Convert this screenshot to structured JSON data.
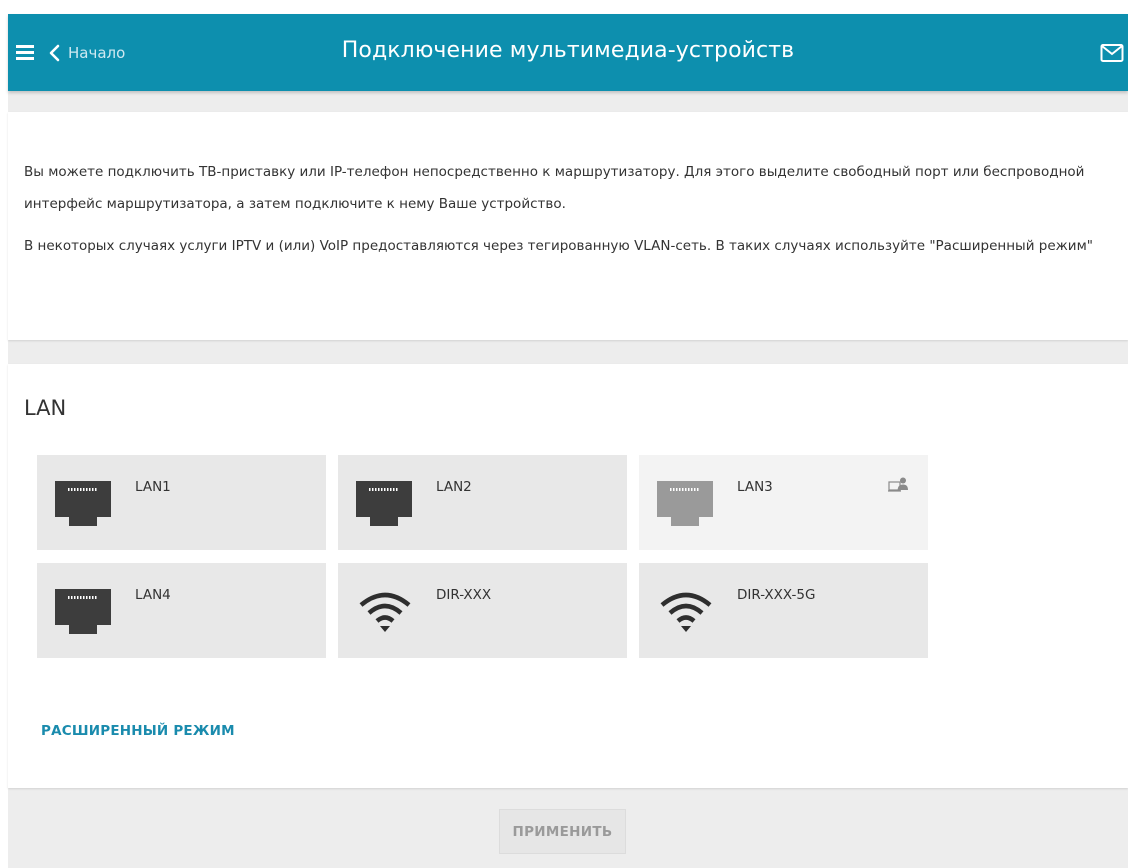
{
  "header": {
    "back_label": "Начало",
    "title": "Подключение мультимедиа-устройств",
    "menu_icon": "hamburger-menu-icon",
    "back_icon": "chevron-left-icon",
    "notifications_icon": "envelope-icon",
    "color": "#0d8fae"
  },
  "info": {
    "paragraph1": "Вы можете подключить ТВ-приставку или IP-телефон непосредственно к маршрутизатору. Для этого выделите свободный порт или беспроводной интерфейс маршрутизатора, а затем подключите к нему Ваше устройство.",
    "paragraph2": "В некоторых случаях услуги IPTV и (или) VoIP предоставляются через тегированную VLAN-сеть. В таких случаях используйте \"Расширенный режим\""
  },
  "lan_section": {
    "title": "LAN",
    "ports": [
      {
        "label": "LAN1",
        "type": "ethernet",
        "enabled": true
      },
      {
        "label": "LAN2",
        "type": "ethernet",
        "enabled": true
      },
      {
        "label": "LAN3",
        "type": "ethernet",
        "enabled": false,
        "status_icon": "connected-computer-icon"
      },
      {
        "label": "LAN4",
        "type": "ethernet",
        "enabled": true
      },
      {
        "label": "DIR-XXX",
        "type": "wifi",
        "enabled": true
      },
      {
        "label": "DIR-XXX-5G",
        "type": "wifi",
        "enabled": true
      }
    ],
    "advanced_link": "РАСШИРЕННЫЙ РЕЖИМ"
  },
  "footer": {
    "apply_label": "ПРИМЕНИТЬ"
  }
}
